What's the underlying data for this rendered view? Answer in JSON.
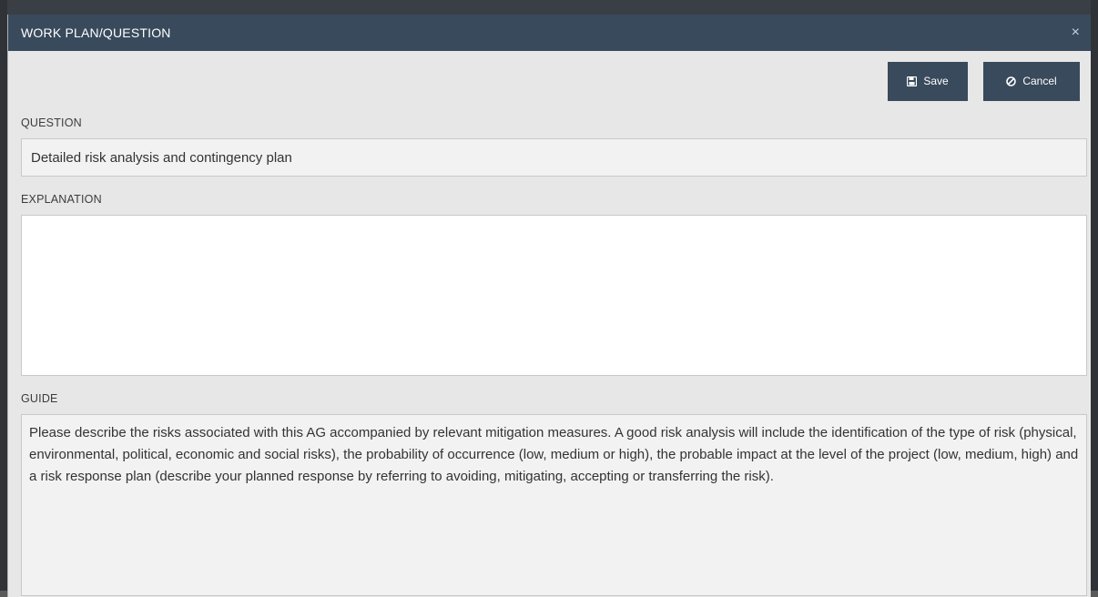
{
  "modal": {
    "title": "WORK PLAN/QUESTION",
    "close_glyph": "×"
  },
  "toolbar": {
    "save_label": "Save",
    "cancel_label": "Cancel",
    "save_icon": "floppy-disk-icon",
    "cancel_icon": "ban-icon"
  },
  "form": {
    "question_label": "QUESTION",
    "question_value": "Detailed risk analysis and contingency plan",
    "explanation_label": "EXPLANATION",
    "explanation_value": "",
    "guide_label": "GUIDE",
    "guide_text": "Please describe the risks associated with this AG accompanied by relevant mitigation measures. A good risk analysis will include the identification of the type of risk (physical, environmental, political, economic and social risks), the probability of occurrence (low, medium or high), the probable impact at the level of the project (low, medium, high) and a risk response plan (describe your planned response by referring to avoiding, mitigating, accepting or transferring the risk)."
  },
  "colors": {
    "header_bg": "#384a5c",
    "button_bg": "#384a5c",
    "modal_bg": "#e7e7e7"
  }
}
